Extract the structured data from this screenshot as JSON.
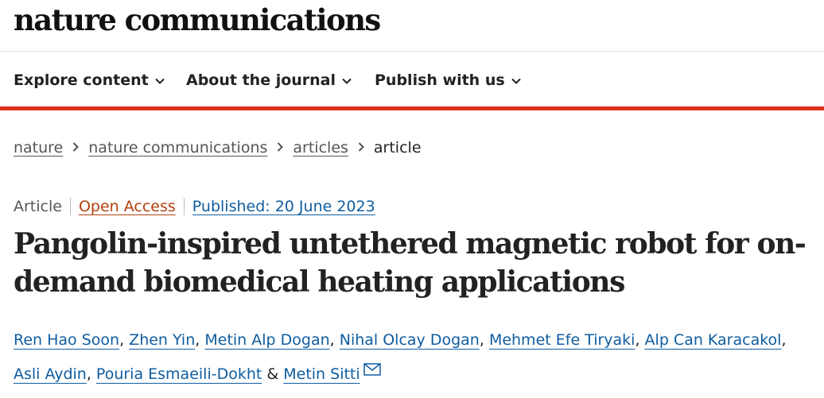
{
  "site": {
    "logo": "nature communications"
  },
  "nav": {
    "items": [
      {
        "label": "Explore content"
      },
      {
        "label": "About the journal"
      },
      {
        "label": "Publish with us"
      }
    ]
  },
  "breadcrumb": {
    "items": [
      {
        "label": "nature"
      },
      {
        "label": "nature communications"
      },
      {
        "label": "articles"
      }
    ],
    "current": "article"
  },
  "article": {
    "type": "Article",
    "access": "Open Access",
    "published": "Published: 20 June 2023",
    "title": "Pangolin-inspired untethered magnetic robot for on-demand biomedical heating applications",
    "authors": [
      "Ren Hao Soon",
      "Zhen Yin",
      "Metin Alp Dogan",
      "Nihal Olcay Dogan",
      "Mehmet Efe Tiryaki",
      "Alp Can Karacakol",
      "Asli Aydin",
      "Pouria Esmaeili-Dokht",
      "Metin Sitti"
    ],
    "author_separator": ", ",
    "last_separator": " & "
  },
  "colors": {
    "accent_red": "#e0301e",
    "link_blue": "#0f5da0",
    "open_access": "#b33f0d"
  },
  "icons": {
    "nav_chevron": "chevron-down-icon",
    "breadcrumb_sep": "chevron-right-icon",
    "corresponding": "envelope-icon"
  }
}
